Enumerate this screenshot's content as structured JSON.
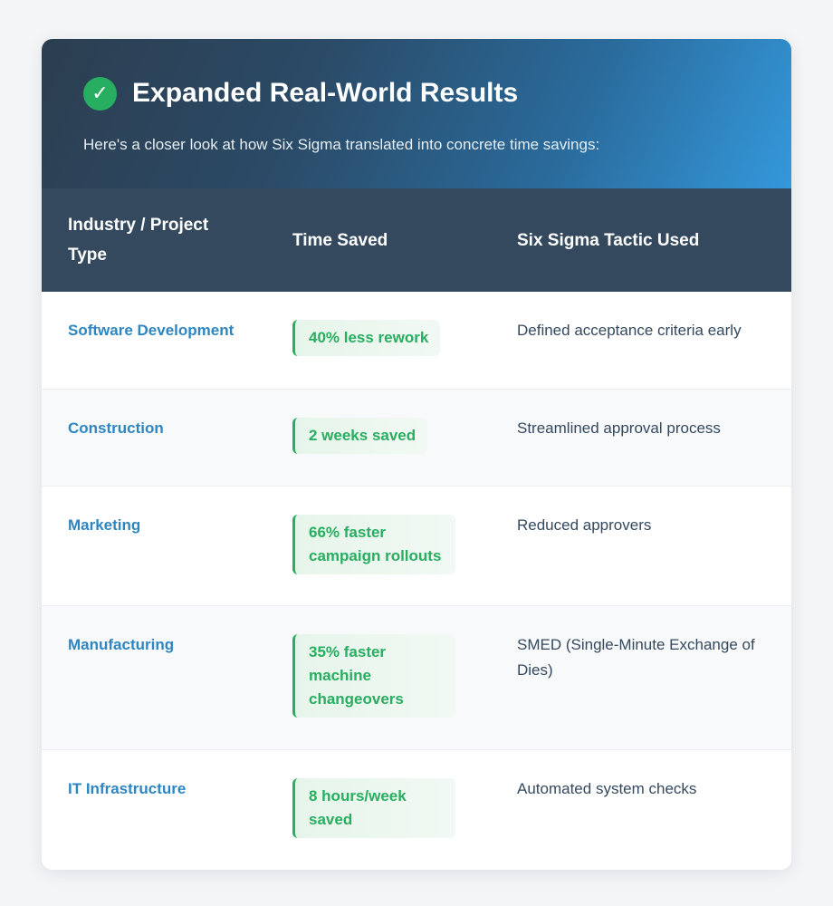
{
  "header": {
    "check_icon": "check-circle-icon",
    "title": "Expanded Real-World Results",
    "subtitle": "Here's a closer look at how Six Sigma translated into concrete time savings:"
  },
  "table": {
    "columns": [
      "Industry / Project Type",
      "Time Saved",
      "Six Sigma Tactic Used"
    ],
    "rows": [
      {
        "industry": "Software Development",
        "time_saved": "40% less rework",
        "tactic": "Defined acceptance criteria early"
      },
      {
        "industry": "Construction",
        "time_saved": "2 weeks saved",
        "tactic": "Streamlined approval process"
      },
      {
        "industry": "Marketing",
        "time_saved": "66% faster campaign rollouts",
        "tactic": "Reduced approvers"
      },
      {
        "industry": "Manufacturing",
        "time_saved": "35% faster machine changeovers",
        "tactic": "SMED (Single-Minute Exchange of Dies)"
      },
      {
        "industry": "IT Infrastructure",
        "time_saved": "8 hours/week saved",
        "tactic": "Automated system checks"
      }
    ]
  },
  "colors": {
    "header_gradient_start": "#2c3e50",
    "header_gradient_end": "#3498db",
    "table_header": "#34495e",
    "industry_text": "#2e86c1",
    "badge_green": "#27ae60",
    "check_green": "#27ae60"
  }
}
